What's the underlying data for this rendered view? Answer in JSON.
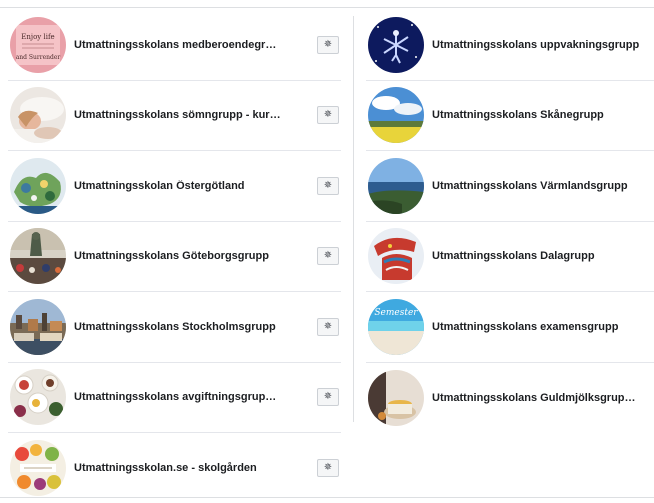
{
  "groups_left": [
    {
      "name": "Utmattningsskolans medberoendegr…",
      "avatar_icon": "poster-pink-text",
      "settings_icon": "gear-icon"
    },
    {
      "name": "Utmattningsskolans sömngrupp - kur…",
      "avatar_icon": "sleeping-woman-photo",
      "settings_icon": "gear-icon"
    },
    {
      "name": "Utmattningsskolan Östergötland",
      "avatar_icon": "regional-map-photo",
      "settings_icon": "gear-icon"
    },
    {
      "name": "Utmattningsskolans Göteborgsgrupp",
      "avatar_icon": "harbour-statue-photo",
      "settings_icon": "gear-icon"
    },
    {
      "name": "Utmattningsskolans Stockholmsgrupp",
      "avatar_icon": "city-rooftops-photo",
      "settings_icon": "gear-icon"
    },
    {
      "name": "Utmattningsskolans avgiftningsgrup…",
      "avatar_icon": "breakfast-table-photo",
      "settings_icon": "gear-icon"
    },
    {
      "name": "Utmattningsskolan.se - skolgården",
      "avatar_icon": "fruit-collage-photo",
      "settings_icon": "gear-icon"
    }
  ],
  "groups_right": [
    {
      "name": "Utmattningsskolans uppvakningsgrupp",
      "avatar_icon": "starry-figure-photo"
    },
    {
      "name": "Utmattningsskolans Skånegrupp",
      "avatar_icon": "field-sky-photo"
    },
    {
      "name": "Utmattningsskolans Värmlandsgrupp",
      "avatar_icon": "lake-view-photo"
    },
    {
      "name": "Utmattningsskolans Dalagrupp",
      "avatar_icon": "dala-horse-photo"
    },
    {
      "name": "Utmattningsskolans examensgrupp",
      "avatar_icon": "semester-beach-photo"
    },
    {
      "name": "Utmattningsskolans Guldmjölksgrup…",
      "avatar_icon": "golden-milk-cup-photo"
    }
  ],
  "avatar_lettering": {
    "poster_top": "Enjoy life",
    "poster_bottom": "and Surrender",
    "beach_word": "Semester"
  },
  "gear_glyph": "✵"
}
